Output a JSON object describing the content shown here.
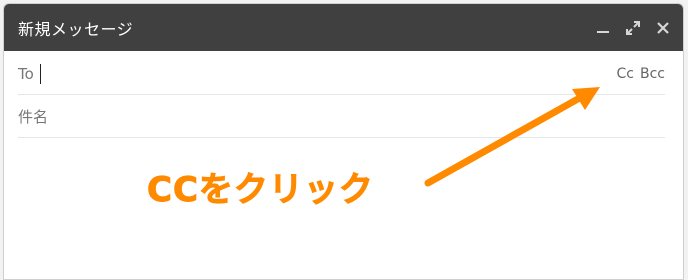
{
  "window": {
    "title": "新規メッセージ"
  },
  "controls": {
    "minimize_icon": "minimize-icon",
    "expand_icon": "expand-icon",
    "close_icon": "close-icon"
  },
  "fields": {
    "to_label": "To",
    "cc_label": "Cc",
    "bcc_label": "Bcc",
    "subject_placeholder": "件名"
  },
  "annotation": {
    "text": "CCをクリック",
    "color": "#ff8a00"
  },
  "colors": {
    "titlebar": "#404040"
  }
}
